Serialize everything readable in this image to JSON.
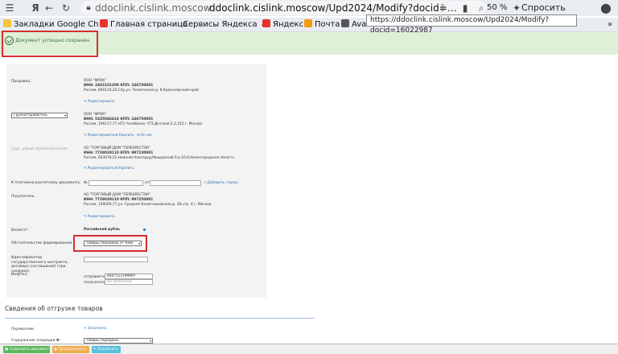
{
  "browser": {
    "url_domain": "ddoclink.cislink.moscow",
    "url_full": "ddoclink.cislink.moscow/Upd2024/Modify?docid=…",
    "zoom": "50 %",
    "ask_label": "Спросить",
    "tooltip": "https://ddoclink.cislink.moscow/Upd2024/Modify?docid=16022987"
  },
  "bookmarks": [
    {
      "label": "Закладки Google Ch",
      "icon": "folder-icon"
    },
    {
      "label": "Главная страница",
      "icon": "yandex-icon"
    },
    {
      "label": "Сервисы Яндекса",
      "icon": "chevron-down-icon"
    },
    {
      "label": "Яндекс",
      "icon": "yandex-icon"
    },
    {
      "label": "Почта",
      "icon": "mail-icon"
    },
    {
      "label": "Ava",
      "icon": "app-icon"
    }
  ],
  "alert": {
    "text": "Документ успешно сохранен"
  },
  "form": {
    "seller": {
      "label": "Продавец:",
      "name": "ООО \"ФРОК\"",
      "ids": "ИНН: 2465101209 КПП: 246750001",
      "address": "Россия, 660110,24,City,ул. Полигонная,д. 8,Красноярский край",
      "edit": "Редактировать"
    },
    "consignor": {
      "select": "Грузоотправитель",
      "name": "ООО \"ФРОК\"",
      "ids": "ИНН: 5435046416 КПП: 246750001",
      "address": "Россия, 106117,77,НТЗ Челябинск ЧТЗ,Детская,5,2,152,г. Москва",
      "edit": "Редактировать",
      "delete": "Удалить",
      "same": "Он же"
    },
    "consignee": {
      "label": "Груз, улица грузополучателя",
      "name": "АО \"ТОРГОВЫЙ ДОМ \"ПЕРЕКРЕСТОК\"",
      "ids": "ИНН: 7728029110 КПП: 997230001",
      "address": "Россия, 603078,52,Нижний Новгород,Мещерский б-р,10,6,Нижегородская область",
      "edit": "Редактировать",
      "delete": "Удалить"
    },
    "payment_doc": {
      "label": "К платежно-расчетному документу:",
      "num_prefix": "№",
      "date_prefix": "от",
      "add_link": "Добавить строку"
    },
    "buyer": {
      "label": "Покупатель:",
      "name": "АО \"ТОРГОВЫЙ ДОМ \"ПЕРЕКРЕСТОК\"",
      "ids": "ИНН: 7728029110 КПП: 997250001",
      "address": "Россия, 109029,77,ул. Средняя Калитниковская,д. 28,стр. 4,г. Москва",
      "edit": "Редактировать"
    },
    "currency": {
      "label": "Валюта*:",
      "value": "Российский рубль"
    },
    "circumstance": {
      "label": "Обстоятельство формирования:",
      "value": "Товары переданы от Комі"
    },
    "gov_contract": {
      "label": "Идентификатор государственного контракта, договора (соглашения) (при наличии):"
    },
    "info_field": {
      "label": "ИнфПол:",
      "sender_label": "отправитель:",
      "sender_value": "4607113799997",
      "receiver_label": "получатель:",
      "receiver_placeholder": "Не заполнено"
    }
  },
  "shipping": {
    "title": "Сведения об отгрузке товаров",
    "carrier_label": "Перевозчик:",
    "carrier_link": "Заполнить",
    "operation_label": "Содержание операции ✱:",
    "operation_value": "Товары переданы"
  },
  "actions": [
    {
      "label": "Сохранить документ",
      "color": "#5cb85c"
    },
    {
      "label": "Предпросмотр",
      "color": "#f0ad4e"
    },
    {
      "label": "Подписать",
      "color": "#5bc0de"
    }
  ]
}
